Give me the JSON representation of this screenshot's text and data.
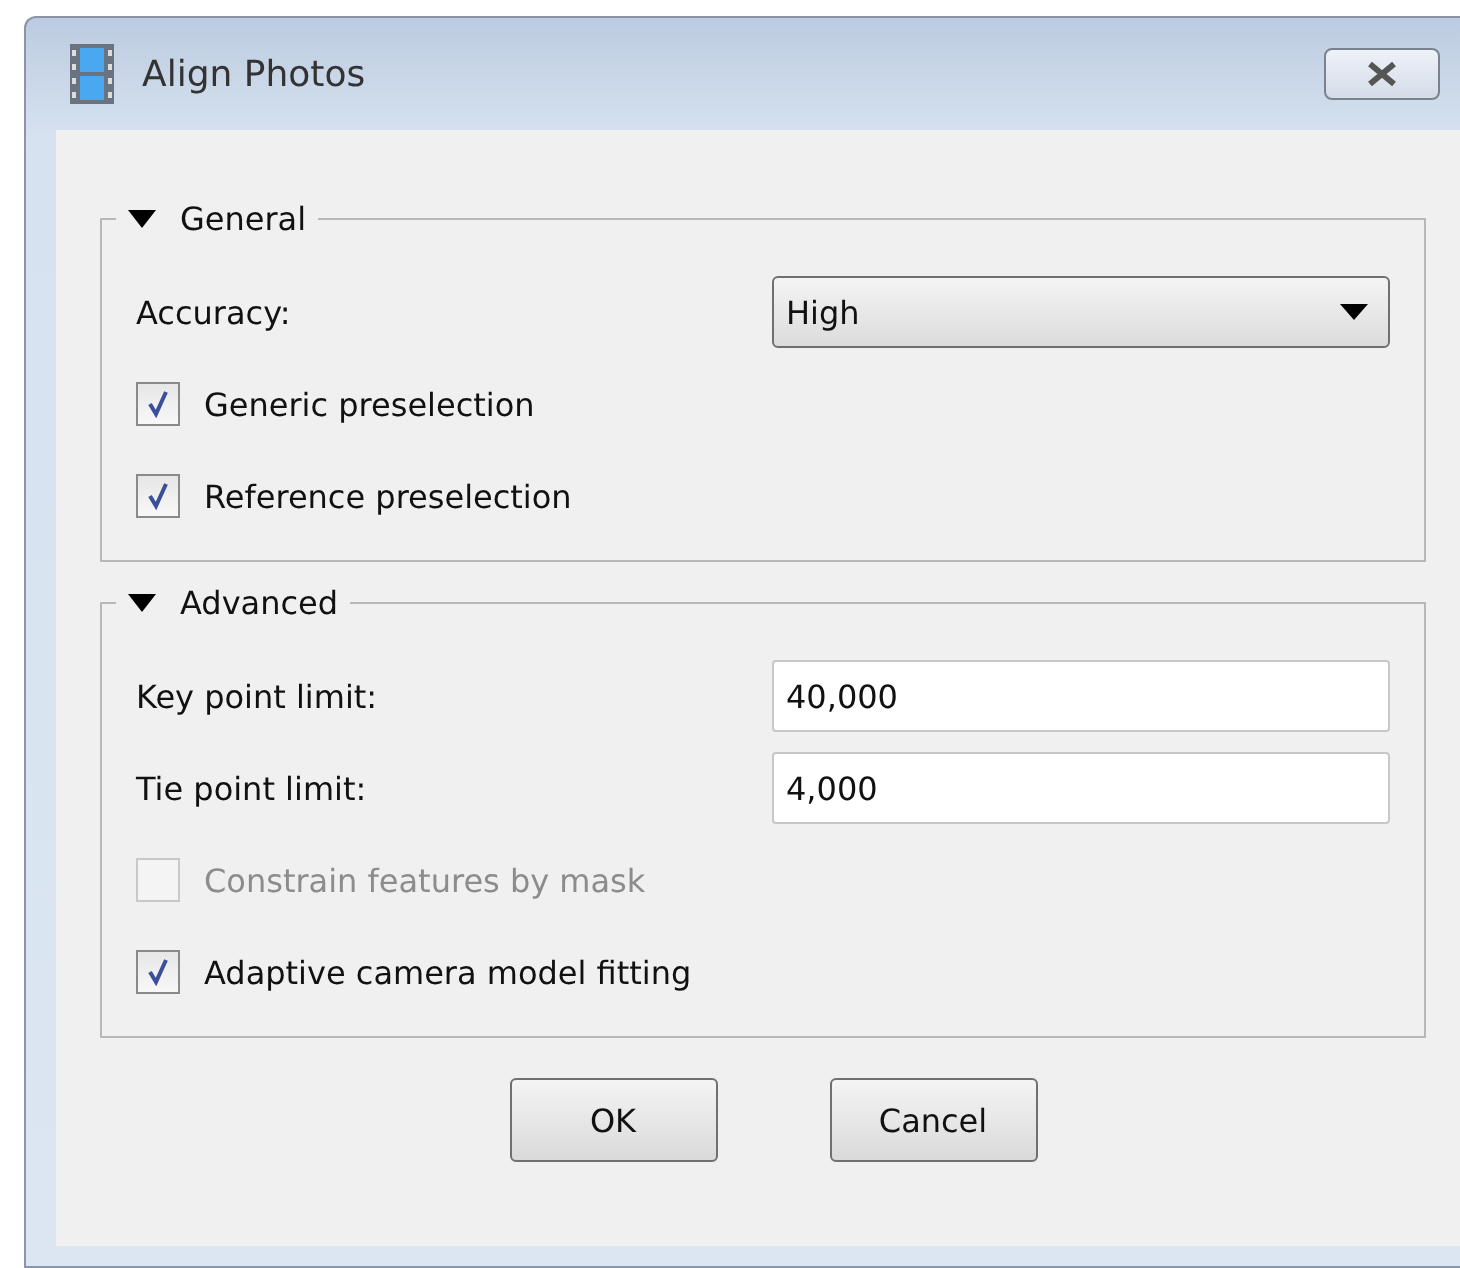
{
  "window": {
    "title": "Align Photos"
  },
  "groups": [
    {
      "title": "General",
      "expanded": true,
      "items": [
        {
          "kind": "combo",
          "label": "Accuracy:",
          "value": "High"
        },
        {
          "kind": "checkbox",
          "label": "Generic preselection",
          "checked": true,
          "disabled": false
        },
        {
          "kind": "checkbox",
          "label": "Reference preselection",
          "checked": true,
          "disabled": false
        }
      ]
    },
    {
      "title": "Advanced",
      "expanded": true,
      "items": [
        {
          "kind": "field",
          "label": "Key point limit:",
          "value": "40,000"
        },
        {
          "kind": "field",
          "label": "Tie point limit:",
          "value": "4,000"
        },
        {
          "kind": "checkbox",
          "label": "Constrain features by mask",
          "checked": false,
          "disabled": true
        },
        {
          "kind": "checkbox",
          "label": "Adaptive camera model fitting",
          "checked": true,
          "disabled": false
        }
      ]
    }
  ],
  "buttons": [
    "OK",
    "Cancel"
  ]
}
